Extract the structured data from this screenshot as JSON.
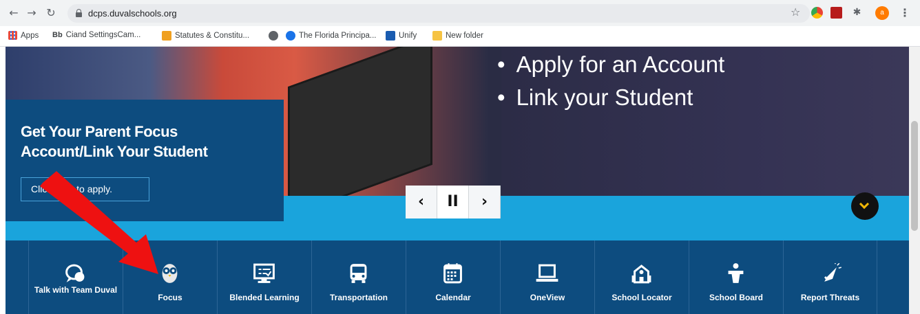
{
  "browser": {
    "url": "dcps.duvalschools.org",
    "profile_initial": "a",
    "bookmarks": [
      {
        "label": "Apps",
        "icon": "apps-grid-icon",
        "color": "#e84a3c"
      },
      {
        "label": "Ciand SettingsCam...",
        "icon": "bb-icon",
        "color": "#000000",
        "prefix": "Bb"
      },
      {
        "label": "Statutes & Constitu...",
        "icon": "florida-leg-icon",
        "color": "#f0a020"
      },
      {
        "label": "",
        "icon": "globe-icon",
        "color": "#5f6368"
      },
      {
        "label": "The Florida Principa...",
        "icon": "florida-principal-icon",
        "color": "#1a73e8"
      },
      {
        "label": "Unify",
        "icon": "unify-icon",
        "color": "#1a5cb0"
      },
      {
        "label": "New folder",
        "icon": "folder-icon",
        "color": "#f6c343"
      }
    ]
  },
  "hero": {
    "bullets": [
      "Apply for an Account",
      "Link your Student"
    ],
    "promo_title": "Get Your Parent Focus Account/Link Your Student",
    "promo_button": "Click here to apply.",
    "controls": {
      "prev": "‹",
      "pause": "II",
      "next": "›"
    }
  },
  "nav": {
    "items": [
      {
        "label": "Talk with Team Duval",
        "icon": "chat-bubble-icon"
      },
      {
        "label": "Focus",
        "icon": "owl-icon"
      },
      {
        "label": "Blended Learning",
        "icon": "monitor-checklist-icon"
      },
      {
        "label": "Transportation",
        "icon": "bus-icon"
      },
      {
        "label": "Calendar",
        "icon": "calendar-icon"
      },
      {
        "label": "OneView",
        "icon": "laptop-icon"
      },
      {
        "label": "School Locator",
        "icon": "school-building-icon"
      },
      {
        "label": "School Board",
        "icon": "podium-speaker-icon"
      },
      {
        "label": "Report Threats",
        "icon": "megaphone-icon"
      }
    ]
  },
  "colors": {
    "navy": "#0d4c7f",
    "sky": "#1aa4dc",
    "accent_yellow": "#f2b705",
    "annotation_red": "#ee1111"
  }
}
